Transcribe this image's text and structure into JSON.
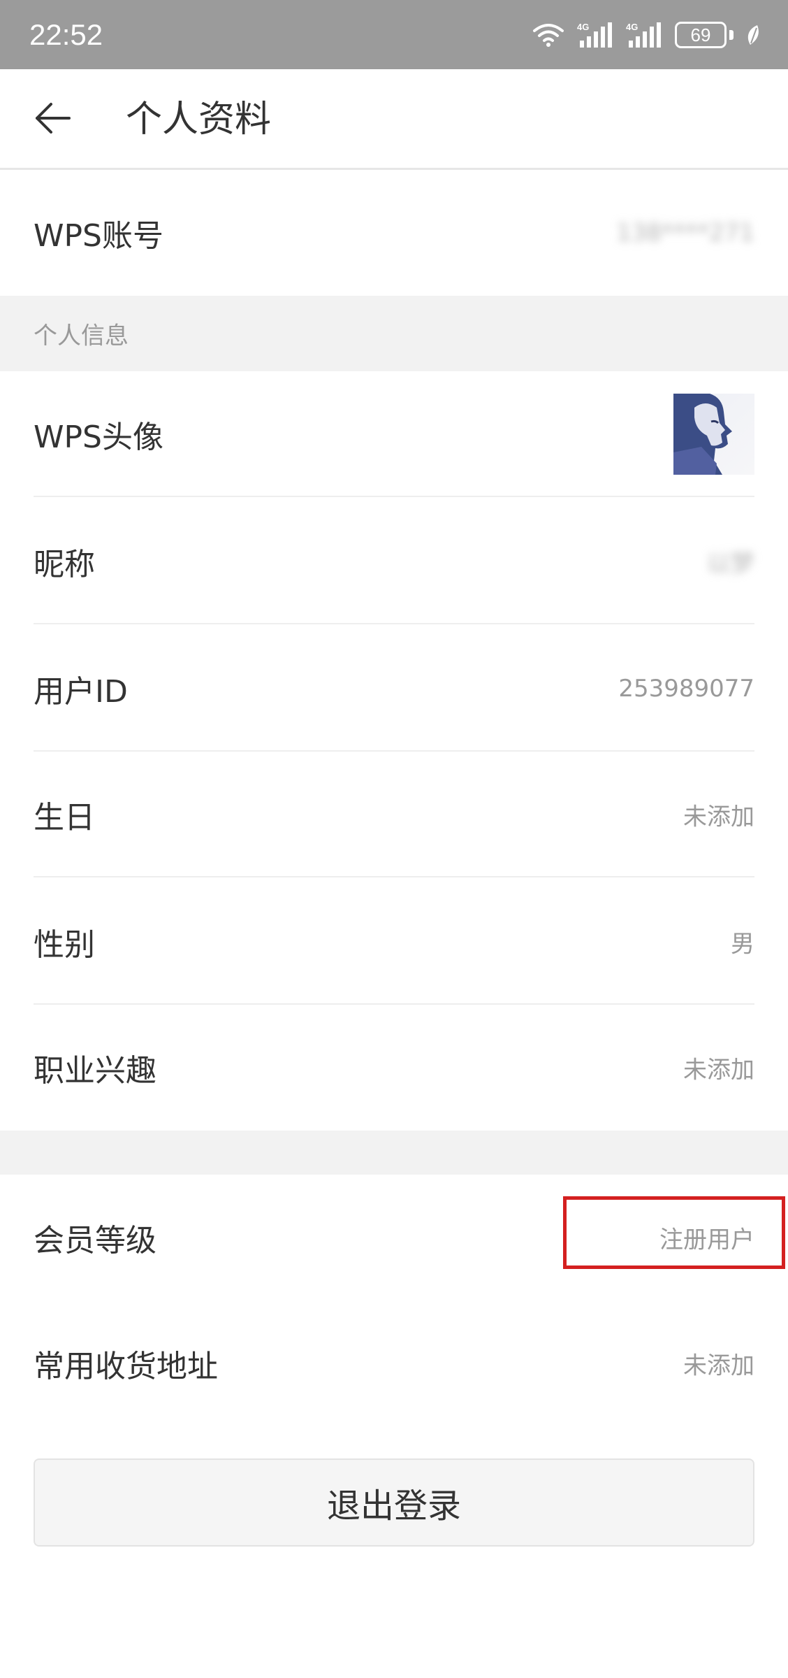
{
  "status_bar": {
    "time": "22:52",
    "battery_level": "69",
    "icons": [
      "wifi-icon",
      "signal-4g-icon",
      "signal-4g-icon",
      "battery-icon",
      "leaf-icon"
    ]
  },
  "header": {
    "back_icon": "arrow-left-icon",
    "title": "个人资料"
  },
  "account": {
    "label": "WPS账号",
    "value": "138****271"
  },
  "section_personal": {
    "label": "个人信息"
  },
  "rows": {
    "avatar": {
      "label": "WPS头像"
    },
    "nickname": {
      "label": "昵称",
      "value": "以梦"
    },
    "user_id": {
      "label": "用户ID",
      "value": "253989077"
    },
    "birthday": {
      "label": "生日",
      "value": "未添加"
    },
    "gender": {
      "label": "性别",
      "value": "男"
    },
    "career": {
      "label": "职业兴趣",
      "value": "未添加"
    },
    "membership": {
      "label": "会员等级",
      "value": "注册用户"
    },
    "address": {
      "label": "常用收货地址",
      "value": "未添加"
    }
  },
  "logout_button": {
    "label": "退出登录"
  },
  "colors": {
    "status_bar_bg": "#9b9b9b",
    "section_bg": "#f2f2f2",
    "highlight": "#d42020",
    "value_text": "#999999"
  }
}
